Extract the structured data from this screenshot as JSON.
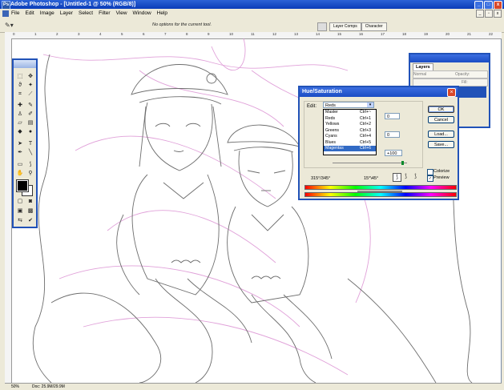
{
  "app": {
    "title": "Adobe Photoshop - [Untitled-1 @ 50% (RGB/8)]",
    "icon": "photoshop-icon",
    "window_controls": [
      "_",
      "□",
      "x"
    ]
  },
  "menu": {
    "items": [
      "File",
      "Edit",
      "Image",
      "Layer",
      "Select",
      "Filter",
      "View",
      "Window",
      "Help"
    ]
  },
  "options_bar": {
    "message": "No options for the current tool.",
    "tool_icon": "eyedropper-icon",
    "palette_well_tabs": [
      "Layer Comps",
      "Character"
    ]
  },
  "ruler": {
    "labels": [
      "0",
      "1",
      "2",
      "3",
      "4",
      "5",
      "6",
      "7",
      "8",
      "9",
      "10",
      "11",
      "12",
      "13",
      "14",
      "15",
      "16",
      "17",
      "18",
      "19",
      "20",
      "21",
      "22"
    ]
  },
  "status": {
    "zoom": "50%",
    "doc": "Doc: 25.9M/29.9M"
  },
  "layers_palette": {
    "tab": "Layers",
    "blend_mode": "Normal",
    "opacity_label": "Opacity:",
    "fill_label": "Fill:"
  },
  "hue_saturation": {
    "title": "Hue/Saturation",
    "edit_label": "Edit:",
    "edit_value": "Reds",
    "options": [
      {
        "name": "Master",
        "shortcut": "Ctrl+~"
      },
      {
        "name": "Reds",
        "shortcut": "Ctrl+1"
      },
      {
        "name": "Yellows",
        "shortcut": "Ctrl+2"
      },
      {
        "name": "Greens",
        "shortcut": "Ctrl+3"
      },
      {
        "name": "Cyans",
        "shortcut": "Ctrl+4"
      },
      {
        "name": "Blues",
        "shortcut": "Ctrl+5"
      },
      {
        "name": "Magentas",
        "shortcut": "Ctrl+6"
      }
    ],
    "selected_option": "Magentas",
    "hue_value": "0",
    "saturation_value": "0",
    "lightness_value": "+100",
    "range_left": "315°/345°",
    "range_right": "15°\\45°",
    "buttons": {
      "ok": "OK",
      "cancel": "Cancel",
      "load": "Load...",
      "save": "Save..."
    },
    "colorize_label": "Colorize",
    "colorize_checked": false,
    "preview_label": "Preview",
    "preview_checked": true
  },
  "colors": {
    "titlebar": "#0a3cb8",
    "sketch_pink": "#d98ad0",
    "sketch_gray": "#6d6d6d",
    "selection": "#316ac5"
  }
}
